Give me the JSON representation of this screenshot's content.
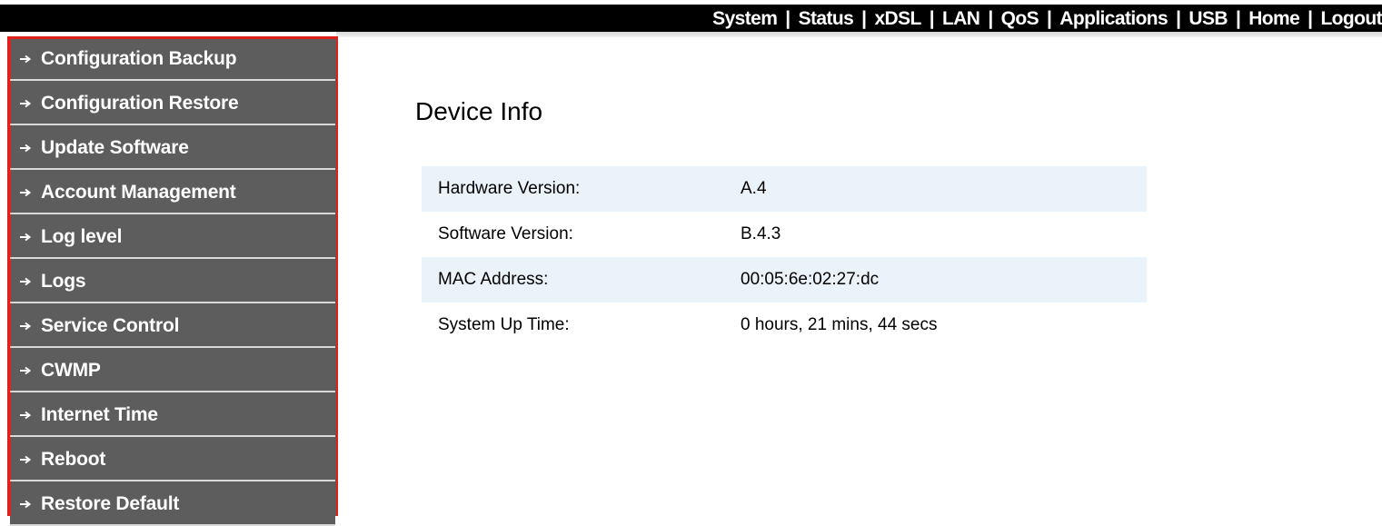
{
  "top_nav": {
    "items": [
      "System",
      "Status",
      "xDSL",
      "LAN",
      "QoS",
      "Applications",
      "USB",
      "Home",
      "Logout"
    ],
    "separator": "|"
  },
  "sidebar": {
    "items": [
      {
        "label": "Configuration Backup"
      },
      {
        "label": "Configuration Restore"
      },
      {
        "label": "Update Software"
      },
      {
        "label": "Account Management"
      },
      {
        "label": "Log level"
      },
      {
        "label": "Logs"
      },
      {
        "label": "Service Control"
      },
      {
        "label": "CWMP"
      },
      {
        "label": "Internet Time"
      },
      {
        "label": "Reboot"
      },
      {
        "label": "Restore Default"
      }
    ],
    "arrow_icon": "arrow-right-icon"
  },
  "main": {
    "title": "Device Info",
    "rows": [
      {
        "label": "Hardware Version:",
        "value": "A.4"
      },
      {
        "label": "Software Version:",
        "value": "B.4.3"
      },
      {
        "label": "MAC Address:",
        "value": "00:05:6e:02:27:dc"
      },
      {
        "label": "System Up Time:",
        "value": "0 hours, 21 mins, 44 secs"
      }
    ]
  },
  "colors": {
    "nav_bg": "#000000",
    "sidebar_bg": "#5d5d5d",
    "sidebar_border": "#e0201b",
    "row_alt_bg": "#eaf2fa"
  }
}
